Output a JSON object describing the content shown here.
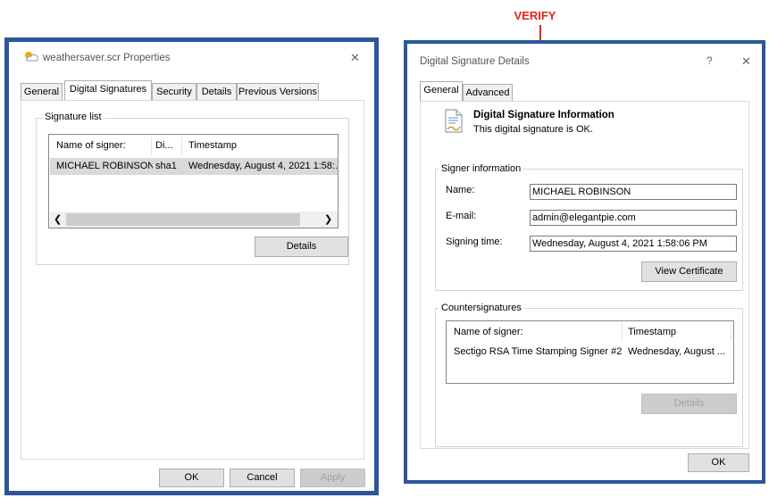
{
  "annotation": {
    "label": "VERIFY",
    "color": "#e0261b"
  },
  "left_window": {
    "title": "weathersaver.scr Properties",
    "close_glyph": "✕",
    "tabs": [
      "General",
      "Digital Signatures",
      "Security",
      "Details",
      "Previous Versions"
    ],
    "active_tab": "Digital Signatures",
    "signature_list": {
      "label": "Signature list",
      "headers": [
        "Name of signer:",
        "Di...",
        "Timestamp"
      ],
      "rows": [
        [
          "MICHAEL ROBINSON",
          "sha1",
          "Wednesday, August 4, 2021 1:58:..."
        ]
      ]
    },
    "details_button": "Details",
    "buttons": {
      "ok": "OK",
      "cancel": "Cancel",
      "apply": "Apply"
    }
  },
  "right_window": {
    "title": "Digital Signature Details",
    "help_glyph": "?",
    "close_glyph": "✕",
    "tabs": [
      "General",
      "Advanced"
    ],
    "active_tab": "General",
    "info_title": "Digital Signature Information",
    "info_status": "This digital signature is OK.",
    "signer_info": {
      "label": "Signer information",
      "name_label": "Name:",
      "name_value": "MICHAEL ROBINSON",
      "email_label": "E-mail:",
      "email_value": "admin@elegantpie.com",
      "time_label": "Signing time:",
      "time_value": "Wednesday, August 4, 2021 1:58:06 PM",
      "view_certificate": "View Certificate"
    },
    "countersignatures": {
      "label": "Countersignatures",
      "headers": [
        "Name of signer:",
        "Timestamp"
      ],
      "rows": [
        [
          "Sectigo RSA Time Stamping Signer #2",
          "Wednesday, August ..."
        ]
      ],
      "details_button": "Details"
    },
    "ok_button": "OK"
  },
  "colors": {
    "window_frame": "#2b579a",
    "button_face": "#e1e1e1",
    "selected_row": "#d9d9d9"
  }
}
